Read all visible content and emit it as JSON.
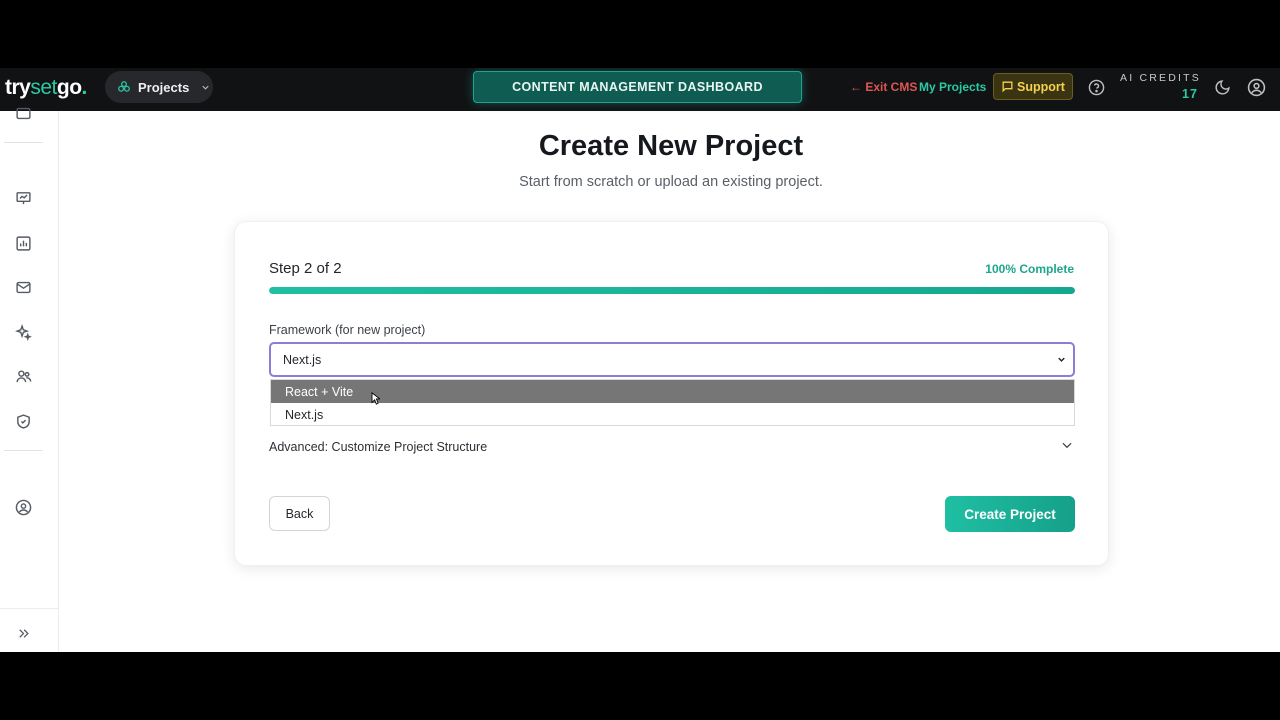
{
  "header": {
    "logo_try": "try",
    "logo_set": "set",
    "logo_go": "go",
    "logo_dot": ".",
    "projects_label": "Projects",
    "banner": "CONTENT MANAGEMENT DASHBOARD",
    "exit_cms": "← Exit CMS",
    "my_projects": "My Projects",
    "support": "Support",
    "credits_label": "AI CREDITS",
    "credits_value": "17"
  },
  "sidebar": {
    "icons": [
      "folder-icon",
      "presentation-icon",
      "bar-chart-icon",
      "mail-icon",
      "sparkles-icon",
      "users-icon",
      "shield-check-icon",
      "user-circle-icon",
      "expand-sidebar-icon"
    ]
  },
  "main": {
    "title": "Create New Project",
    "subtitle": "Start from scratch or upload an existing project.",
    "step": "Step 2 of 2",
    "complete": "100% Complete",
    "progress": 1.0,
    "framework_label": "Framework (for new project)",
    "framework_value": "Next.js",
    "framework_options": [
      "React + Vite",
      "Next.js"
    ],
    "highlighted_option": "React + Vite",
    "advanced_label": "Advanced: Customize Project Structure",
    "back_label": "Back",
    "create_label": "Create Project"
  },
  "colors": {
    "accent": "#1fbfa3",
    "header_bg": "#111214",
    "exit": "#e25555",
    "support": "#f3d24e"
  }
}
